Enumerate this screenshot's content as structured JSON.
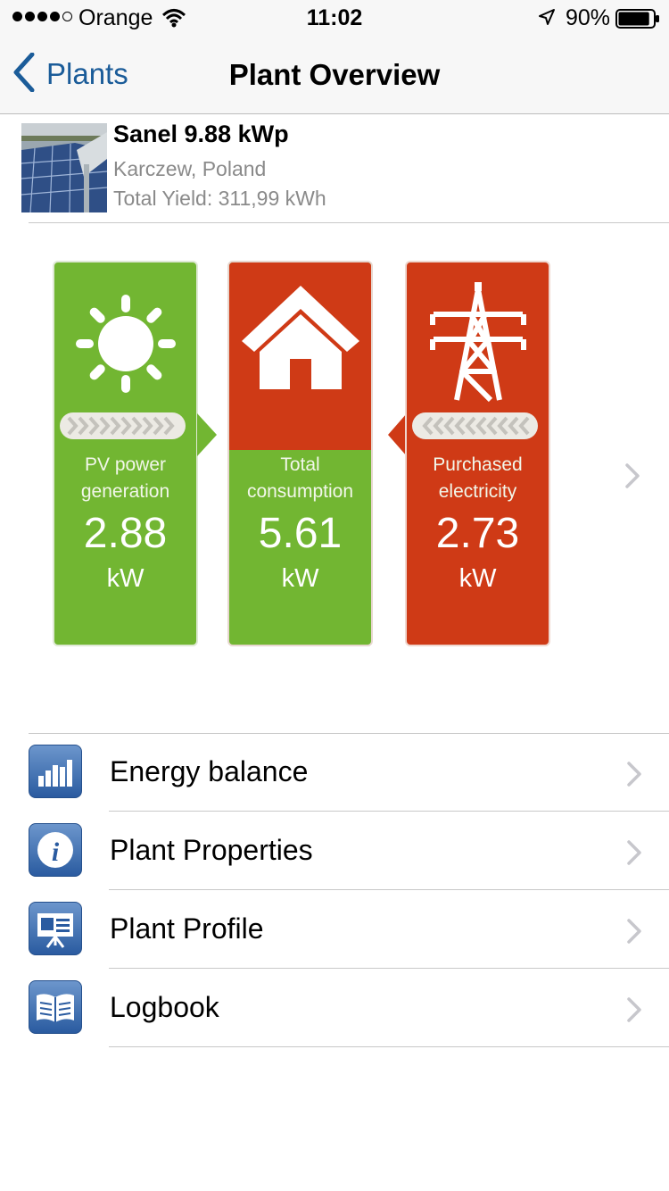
{
  "status_bar": {
    "carrier": "Orange",
    "signal_bars_filled": 4,
    "signal_bars_total": 5,
    "time": "11:02",
    "battery_percent": "90%",
    "battery_level": 0.9
  },
  "nav": {
    "back_label": "Plants",
    "title": "Plant Overview"
  },
  "plant": {
    "name": "Sanel 9.88 kWp",
    "location": "Karczew, Poland",
    "total_yield": "Total Yield: 311,99 kWh"
  },
  "energy_flow": {
    "pv": {
      "label_line1": "PV power",
      "label_line2": "generation",
      "value": "2.88",
      "unit": "kW",
      "color": "#72b632",
      "icon": "sun-icon"
    },
    "consumption": {
      "label_line1": "Total",
      "label_line2": "consumption",
      "value": "5.61",
      "unit": "kW",
      "color_top": "#cf3a16",
      "color_bottom": "#72b632",
      "icon": "house-icon"
    },
    "grid": {
      "label_line1": "Purchased",
      "label_line2": "electricity",
      "value": "2.73",
      "unit": "kW",
      "color": "#cf3a16",
      "icon": "power-pylon-icon"
    }
  },
  "menu": [
    {
      "label": "Energy balance",
      "icon": "bar-chart-icon"
    },
    {
      "label": "Plant Properties",
      "icon": "info-icon"
    },
    {
      "label": "Plant Profile",
      "icon": "presentation-icon"
    },
    {
      "label": "Logbook",
      "icon": "book-icon"
    }
  ],
  "colors": {
    "accent_blue": "#1b5c99",
    "green": "#72b632",
    "red": "#cf3a16",
    "menu_icon_blue": "#2a5ba0"
  }
}
